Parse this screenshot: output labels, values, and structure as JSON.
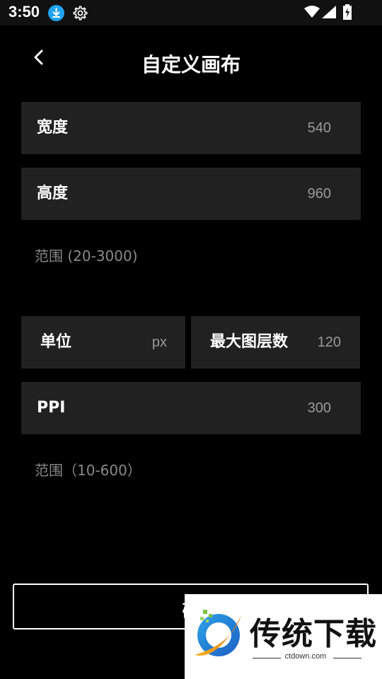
{
  "status_bar": {
    "time": "3:50",
    "icons": [
      "download-icon",
      "gear-icon",
      "wifi-icon",
      "signal-icon",
      "battery-charging-icon"
    ]
  },
  "header": {
    "title": "自定义画布",
    "back_icon": "chevron-left-icon"
  },
  "canvas_size": {
    "width_label": "宽度",
    "width_value": "540",
    "height_label": "高度",
    "height_value": "960",
    "range_hint": "范围 (20-3000)"
  },
  "settings": {
    "unit_label": "单位",
    "unit_value": "px",
    "max_layers_label": "最大图层数",
    "max_layers_value": "120",
    "ppi_label": "PPI",
    "ppi_value": "300",
    "ppi_range_hint": "范围（10-600）"
  },
  "confirm": {
    "label": "确"
  },
  "watermark": {
    "title": "传统下载",
    "url": "ctdown.com"
  },
  "colors": {
    "background": "#000000",
    "row_background": "#212121",
    "value_text": "#9a9a9a",
    "accent_download": "#1fa3f1"
  }
}
